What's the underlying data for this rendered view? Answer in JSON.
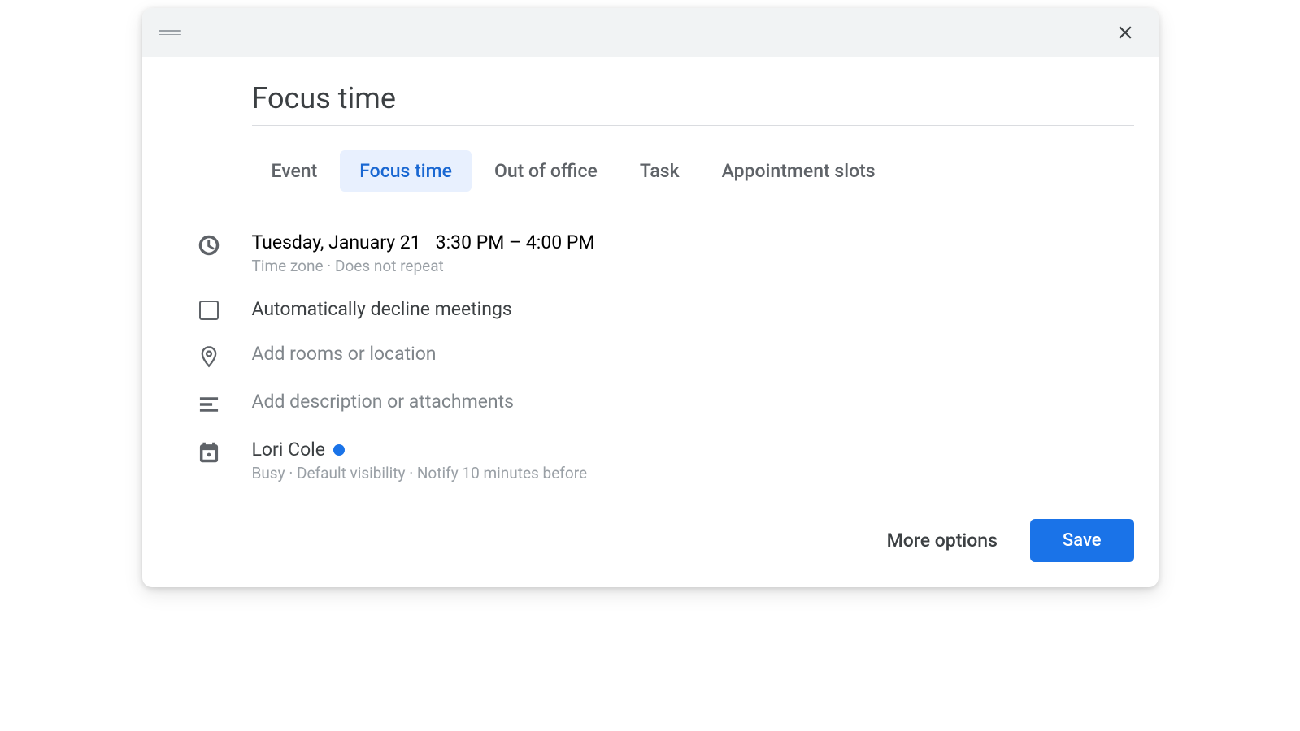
{
  "title": "Focus time",
  "tabs": [
    {
      "label": "Event",
      "active": false
    },
    {
      "label": "Focus time",
      "active": true
    },
    {
      "label": "Out of office",
      "active": false
    },
    {
      "label": "Task",
      "active": false
    },
    {
      "label": "Appointment slots",
      "active": false
    }
  ],
  "datetime": {
    "date": "Tuesday, January 21",
    "time_range": "3:30 PM – 4:00 PM",
    "subtext": "Time zone · Does not repeat"
  },
  "decline_meetings": {
    "label": "Automatically decline meetings",
    "checked": false
  },
  "location": {
    "placeholder": "Add rooms or location"
  },
  "description": {
    "placeholder": "Add description or attachments"
  },
  "calendar": {
    "owner": "Lori Cole",
    "dot_color": "#1a73e8",
    "subtext": "Busy · Default visibility · Notify 10 minutes before"
  },
  "footer": {
    "more_options": "More options",
    "save": "Save"
  }
}
